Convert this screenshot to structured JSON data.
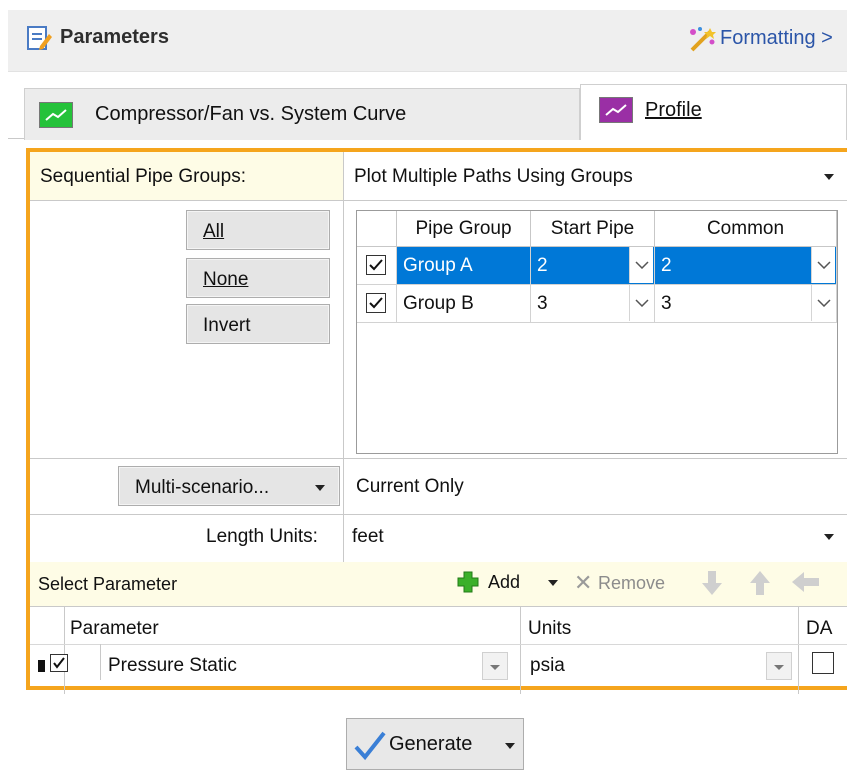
{
  "header": {
    "title": "Parameters",
    "formatting_label": "Formatting >",
    "icon": "parameters-icon",
    "formatting_icon": "formatting-wand-icon"
  },
  "tabs": [
    {
      "label": "Compressor/Fan vs. System Curve",
      "icon": "green-chart-icon",
      "active": false
    },
    {
      "label": "Profile",
      "icon": "purple-chart-icon",
      "active": true
    }
  ],
  "sequential": {
    "label": "Sequential Pipe Groups:",
    "value": "Plot Multiple Paths Using Groups"
  },
  "selection_buttons": {
    "all": "All",
    "none": "None",
    "invert": "Invert"
  },
  "groups_grid": {
    "columns": [
      "Pipe Group",
      "Start Pipe",
      "Common"
    ],
    "rows": [
      {
        "checked": true,
        "group": "Group A",
        "start": "2",
        "common": "2",
        "selected": true
      },
      {
        "checked": true,
        "group": "Group B",
        "start": "3",
        "common": "3",
        "selected": false
      }
    ]
  },
  "scenario": {
    "button_label": "Multi-scenario...",
    "value": "Current Only"
  },
  "length_units": {
    "label": "Length Units:",
    "value": "feet"
  },
  "param_toolbar": {
    "title": "Select Parameter",
    "add": "Add",
    "remove": "Remove"
  },
  "param_table": {
    "columns": [
      "Parameter",
      "Units",
      "DA"
    ],
    "rows": [
      {
        "checked": true,
        "parameter": "Pressure Static",
        "units": "psia",
        "da": false
      }
    ]
  },
  "generate": {
    "label": "Generate"
  },
  "colors": {
    "accent_border": "#f5a51d",
    "selection": "#0078d7",
    "label_bg": "#fefce6"
  }
}
